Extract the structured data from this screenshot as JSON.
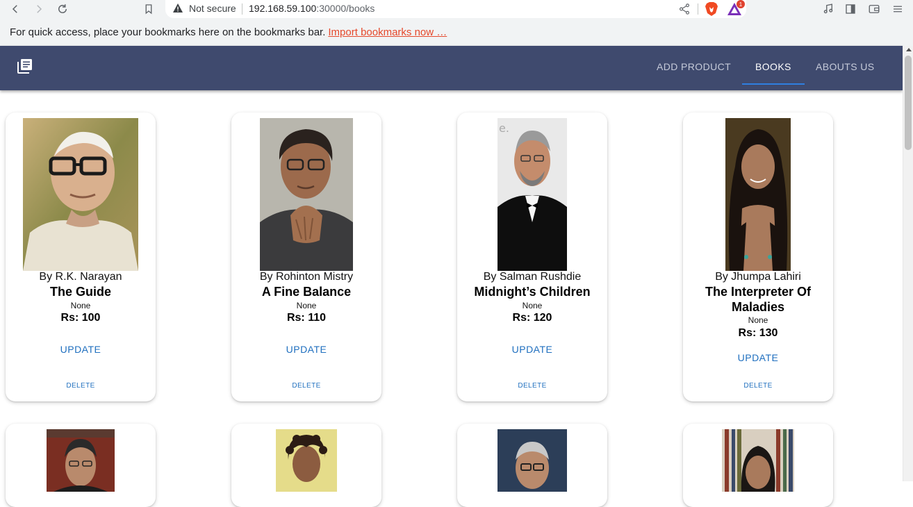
{
  "browser": {
    "security_label": "Not secure",
    "url_host": "192.168.59.100",
    "url_rest": ":30000/books",
    "rewards_count": "1",
    "bookmarks_message": "For quick access, place your bookmarks here on the bookmarks bar.",
    "bookmarks_import_link": "Import bookmarks now …"
  },
  "header": {
    "logo_icon": "library-books-icon",
    "nav": [
      {
        "label": "ADD PRODUCT",
        "active": false
      },
      {
        "label": "BOOKS",
        "active": true
      },
      {
        "label": "ABOUTS US",
        "active": false
      }
    ]
  },
  "books": [
    {
      "author": "By R.K. Narayan",
      "title": "The Guide",
      "description": "None",
      "price": "Rs: 100",
      "update_label": "UPDATE",
      "delete_label": "DELETE"
    },
    {
      "author": "By Rohinton Mistry",
      "title": "A Fine Balance",
      "description": "None",
      "price": "Rs: 110",
      "update_label": "UPDATE",
      "delete_label": "DELETE"
    },
    {
      "author": "By Salman Rushdie",
      "title": "Midnight’s Children",
      "description": "None",
      "price": "Rs: 120",
      "update_label": "UPDATE",
      "delete_label": "DELETE"
    },
    {
      "author": "By Jhumpa Lahiri",
      "title": "The Interpreter Of Maladies",
      "description": "None",
      "price": "Rs: 130",
      "update_label": "UPDATE",
      "delete_label": "DELETE"
    }
  ],
  "colors": {
    "header_bg": "#3f4a6e",
    "active_indicator": "#2f7fe0",
    "button_text": "#1f6fbf",
    "link_orange": "#e5482b"
  }
}
